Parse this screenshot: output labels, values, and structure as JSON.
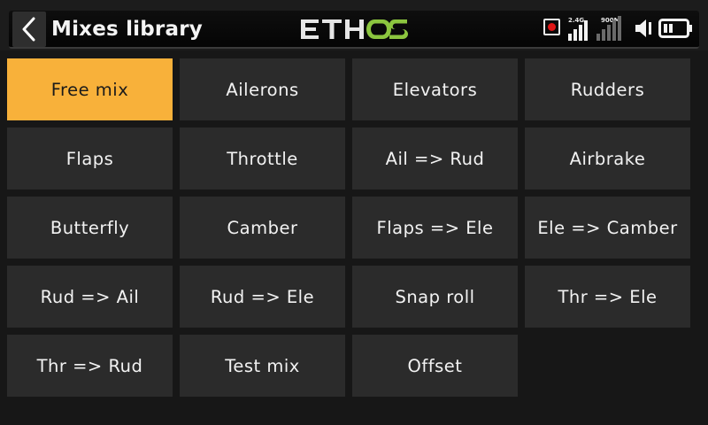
{
  "header": {
    "title": "Mixes library",
    "logo_text": "ETHOS",
    "brand_colors": {
      "main": "#e6e6e6",
      "accent": "#8cc63f"
    },
    "status": {
      "record_icon": "record-icon",
      "rx_2g4_label": "2.4G",
      "rx_900m_label": "900M",
      "rx_2g4_bars_filled": 4,
      "rx_900m_bars_filled": 0,
      "bars_total": 5,
      "volume_icon": "speaker-icon",
      "battery_icon": "battery-icon",
      "battery_level": 0.6
    }
  },
  "colors": {
    "selected": "#f8b13a",
    "tile": "#2b2b2b",
    "background": "#171717"
  },
  "mixes": [
    {
      "label": "Free mix",
      "selected": true
    },
    {
      "label": "Ailerons"
    },
    {
      "label": "Elevators"
    },
    {
      "label": "Rudders"
    },
    {
      "label": "Flaps"
    },
    {
      "label": "Throttle"
    },
    {
      "label": "Ail => Rud"
    },
    {
      "label": "Airbrake"
    },
    {
      "label": "Butterfly"
    },
    {
      "label": "Camber"
    },
    {
      "label": "Flaps => Ele"
    },
    {
      "label": "Ele => Camber"
    },
    {
      "label": "Rud => Ail"
    },
    {
      "label": "Rud => Ele"
    },
    {
      "label": "Snap roll"
    },
    {
      "label": "Thr => Ele"
    },
    {
      "label": "Thr => Rud"
    },
    {
      "label": "Test mix"
    },
    {
      "label": "Offset"
    }
  ]
}
